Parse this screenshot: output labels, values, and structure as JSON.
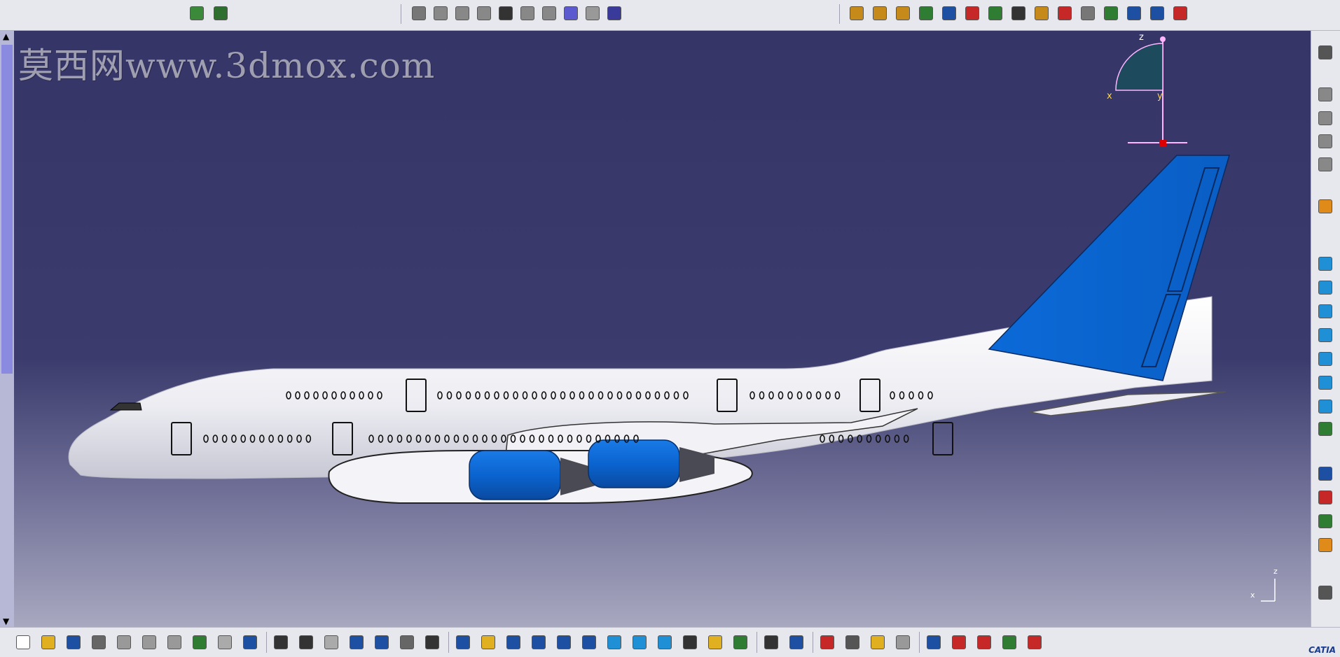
{
  "watermark": "莫西网www.3dmox.com",
  "compass": {
    "z": "z",
    "x": "x",
    "y": "y"
  },
  "mini_axis": {
    "z": "z",
    "x": "x"
  },
  "branding": "CATIA",
  "colors": {
    "viewport_top": "#363568",
    "viewport_bottom": "#a8a8c0",
    "fuselage": "#ffffff",
    "tail": "#0a67d6",
    "engine": "#0a67d6"
  },
  "toolbar_top_left": [
    {
      "name": "knowledge-icon-a",
      "color": "#3a8a3a"
    },
    {
      "name": "knowledge-icon-b",
      "color": "#2e6e2e"
    }
  ],
  "toolbar_top_mid": [
    {
      "name": "sketch-icon",
      "color": "#777"
    },
    {
      "name": "part-icon",
      "color": "#888"
    },
    {
      "name": "shape-icon",
      "color": "#888"
    },
    {
      "name": "support-icon",
      "color": "#888"
    },
    {
      "name": "anchor-icon",
      "color": "#333"
    },
    {
      "name": "pencil-icon",
      "color": "#888"
    },
    {
      "name": "rule-icon",
      "color": "#888"
    },
    {
      "name": "link-icon",
      "color": "#5b5bcf"
    },
    {
      "name": "refresh-icon",
      "color": "#999"
    },
    {
      "name": "grid-icon",
      "color": "#3a3a9a"
    }
  ],
  "toolbar_top_right": [
    {
      "name": "gears-icon-a",
      "color": "#c58a1a"
    },
    {
      "name": "gears-icon-b",
      "color": "#c58a1a"
    },
    {
      "name": "gears-icon-c",
      "color": "#c58a1a"
    },
    {
      "name": "import-icon",
      "color": "#2e7d32"
    },
    {
      "name": "edit-icon",
      "color": "#1d4fa3"
    },
    {
      "name": "remove-icon",
      "color": "#c62828"
    },
    {
      "name": "export-icon",
      "color": "#2e7d32"
    },
    {
      "name": "text-icon",
      "color": "#333"
    },
    {
      "name": "table-icon",
      "color": "#c58a1a"
    },
    {
      "name": "chart-icon",
      "color": "#c62828"
    },
    {
      "name": "settings-icon",
      "color": "#777"
    },
    {
      "name": "cube-icon",
      "color": "#2e7d32"
    },
    {
      "name": "wand-icon",
      "color": "#1d4fa3"
    },
    {
      "name": "tree-icon-a",
      "color": "#1d4fa3"
    },
    {
      "name": "tree-icon-b",
      "color": "#c62828"
    }
  ],
  "toolbar_right": [
    {
      "name": "apply-material-icon",
      "color": "#555"
    },
    {
      "name": "analysis-icon-a",
      "color": "#888"
    },
    {
      "name": "analysis-icon-b",
      "color": "#888"
    },
    {
      "name": "analysis-icon-c",
      "color": "#888"
    },
    {
      "name": "analysis-icon-d",
      "color": "#888"
    },
    {
      "name": "select-icon",
      "color": "#e08a1a"
    },
    {
      "name": "view-iso-icon",
      "color": "#1f8fd6"
    },
    {
      "name": "view-front-icon",
      "color": "#1f8fd6"
    },
    {
      "name": "view-back-icon",
      "color": "#1f8fd6"
    },
    {
      "name": "view-left-icon",
      "color": "#1f8fd6"
    },
    {
      "name": "view-right-icon",
      "color": "#1f8fd6"
    },
    {
      "name": "view-top-icon",
      "color": "#1f8fd6"
    },
    {
      "name": "view-bottom-icon",
      "color": "#1f8fd6"
    },
    {
      "name": "named-views-icon",
      "color": "#2e7d32"
    },
    {
      "name": "render-icon",
      "color": "#1d4fa3"
    },
    {
      "name": "hide-show-icon",
      "color": "#c62828"
    },
    {
      "name": "swap-space-icon",
      "color": "#2e7d32"
    },
    {
      "name": "multi-view-icon",
      "color": "#e08a1a"
    },
    {
      "name": "measure-icon",
      "color": "#555"
    }
  ],
  "toolbar_bottom": [
    {
      "name": "new-icon",
      "color": "#fff"
    },
    {
      "name": "open-icon",
      "color": "#e0b020"
    },
    {
      "name": "save-icon",
      "color": "#1d4fa3"
    },
    {
      "name": "print-icon",
      "color": "#666"
    },
    {
      "name": "cut-icon",
      "color": "#999"
    },
    {
      "name": "copy-icon",
      "color": "#999"
    },
    {
      "name": "paste-icon",
      "color": "#999"
    },
    {
      "name": "undo-icon",
      "color": "#2e7d32"
    },
    {
      "name": "redo-icon",
      "color": "#aaa"
    },
    {
      "name": "whats-this-icon",
      "color": "#1d4fa3"
    },
    {
      "name": "formula-icon",
      "color": "#333"
    },
    {
      "name": "comment-icon",
      "color": "#333"
    },
    {
      "name": "reaction-icon",
      "color": "#aaa"
    },
    {
      "name": "design-table-icon",
      "color": "#1d4fa3"
    },
    {
      "name": "hierarchy-icon",
      "color": "#1d4fa3"
    },
    {
      "name": "lock-icon",
      "color": "#666"
    },
    {
      "name": "list-icon",
      "color": "#333"
    },
    {
      "name": "fly-mode-icon",
      "color": "#1d4fa3"
    },
    {
      "name": "fit-all-icon",
      "color": "#e0b020"
    },
    {
      "name": "pan-icon",
      "color": "#1d4fa3"
    },
    {
      "name": "rotate-icon",
      "color": "#1d4fa3"
    },
    {
      "name": "zoom-in-icon",
      "color": "#1d4fa3"
    },
    {
      "name": "zoom-out-icon",
      "color": "#1d4fa3"
    },
    {
      "name": "normal-view-icon",
      "color": "#1f8fd6"
    },
    {
      "name": "multi-view-icon",
      "color": "#1f8fd6"
    },
    {
      "name": "iso-view-icon",
      "color": "#1f8fd6"
    },
    {
      "name": "shading-icon",
      "color": "#333"
    },
    {
      "name": "show-hide-icon",
      "color": "#e0b020"
    },
    {
      "name": "swap-visible-icon",
      "color": "#2e7d32"
    },
    {
      "name": "capture-icon",
      "color": "#333"
    },
    {
      "name": "catalog-icon",
      "color": "#1d4fa3"
    },
    {
      "name": "measure-between-icon",
      "color": "#c62828"
    },
    {
      "name": "measure-item-icon",
      "color": "#555"
    },
    {
      "name": "measure-inertia-icon",
      "color": "#e0b020"
    },
    {
      "name": "scan-icon",
      "color": "#999"
    },
    {
      "name": "material-icon",
      "color": "#1d4fa3"
    },
    {
      "name": "apply-material-icon",
      "color": "#c62828"
    },
    {
      "name": "apply-color-icon",
      "color": "#c62828"
    },
    {
      "name": "multi-color-icon",
      "color": "#2e7d32"
    },
    {
      "name": "grid-snap-icon",
      "color": "#c62828"
    }
  ]
}
